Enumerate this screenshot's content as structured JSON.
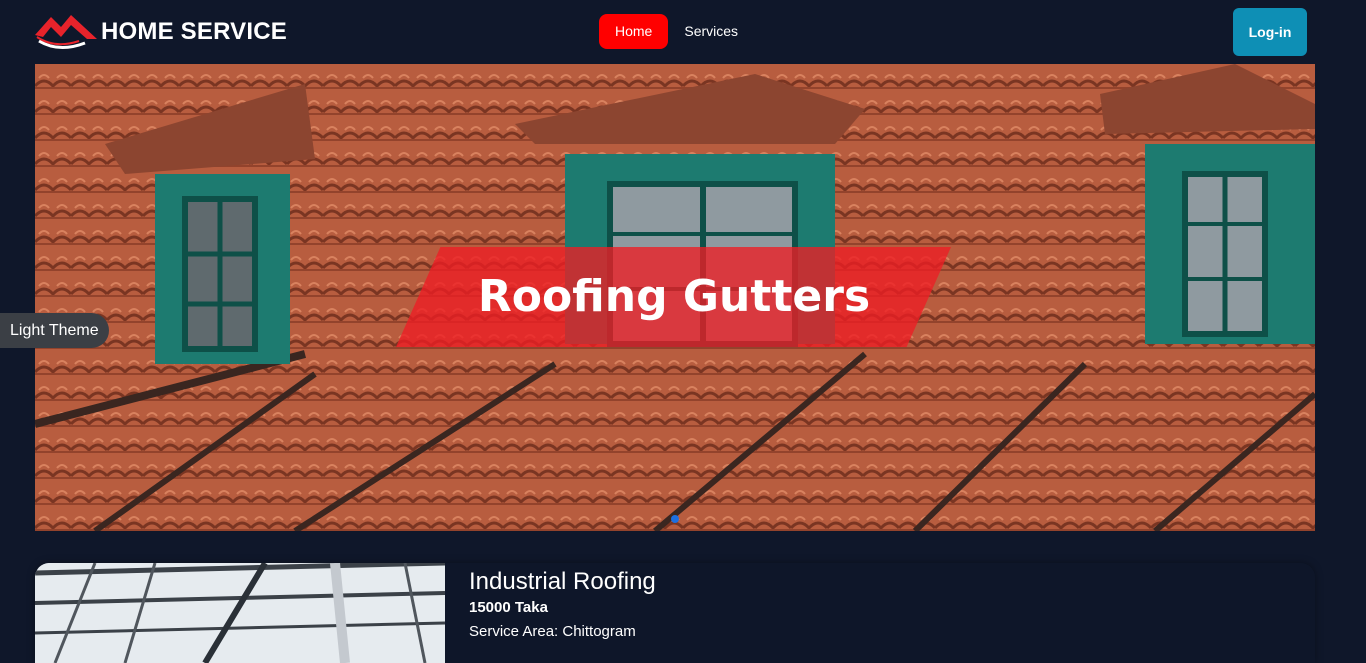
{
  "brand": {
    "name": "HOME SERVICE",
    "logo_icon": "house-roof-logo-icon",
    "colors": {
      "accent": "#ff0000",
      "logo_red": "#e8232b"
    }
  },
  "nav": {
    "items": [
      {
        "label": "Home",
        "active": true
      },
      {
        "label": "Services",
        "active": false
      }
    ],
    "login_label": "Log-in",
    "login_color": "#0e8fb5"
  },
  "hero": {
    "title": "Roofing Gutters",
    "banner_color": "#ee1e24",
    "indicator_color": "#1d6fe0"
  },
  "theme_toggle": {
    "label": "Light Theme"
  },
  "service_card": {
    "title": "Industrial Roofing",
    "price": "15000 Taka",
    "area": "Service Area: Chittogram"
  }
}
